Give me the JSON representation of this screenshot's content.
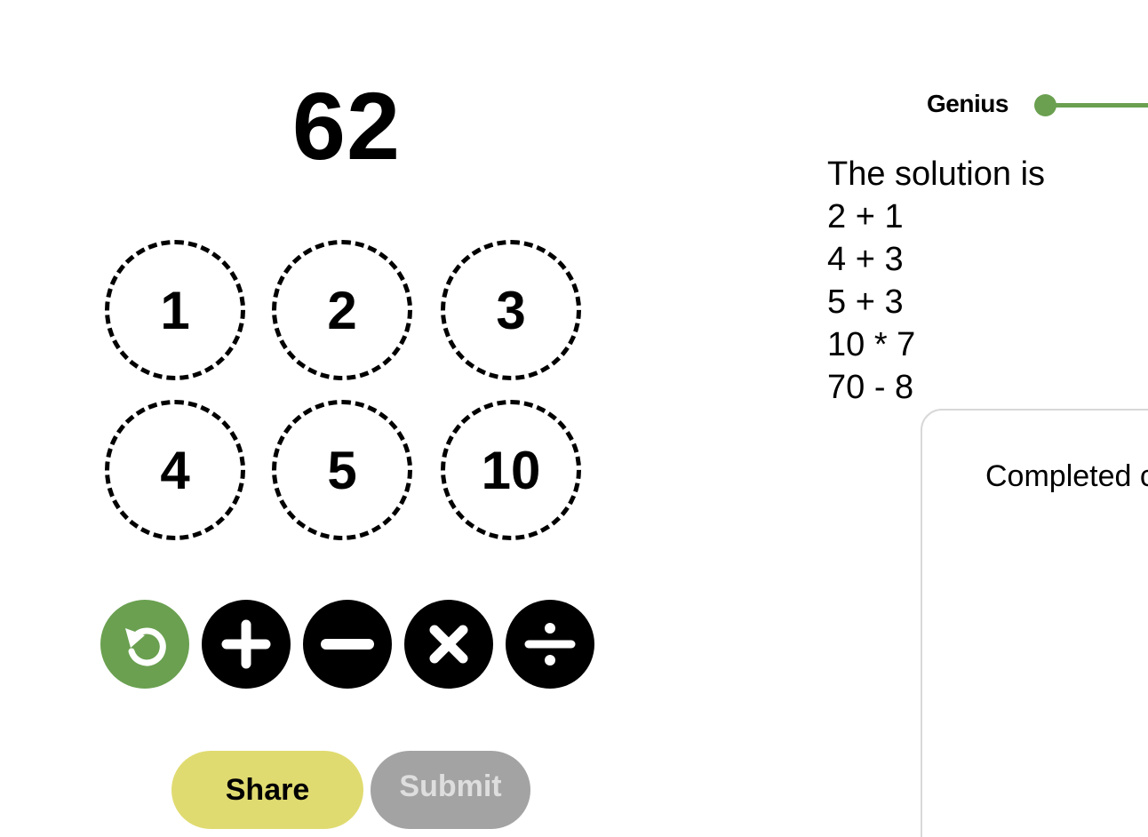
{
  "game": {
    "target": "62",
    "tiles": [
      "1",
      "2",
      "3",
      "4",
      "5",
      "10"
    ],
    "operators": [
      "undo-icon",
      "plus-icon",
      "minus-icon",
      "multiply-icon",
      "divide-icon"
    ],
    "buttons": {
      "share_label": "Share",
      "submit_label": "Submit"
    }
  },
  "level": {
    "label": "Genius"
  },
  "solution": {
    "heading": "The solution is",
    "steps": [
      "2 + 1",
      "4 + 3",
      "5 + 3",
      "10 * 7",
      "70 - 8"
    ]
  },
  "panel": {
    "text": "Completed c"
  },
  "colors": {
    "accent_green": "#6aa050",
    "share_yellow": "#e0db70",
    "submit_gray": "#a3a3a3"
  }
}
